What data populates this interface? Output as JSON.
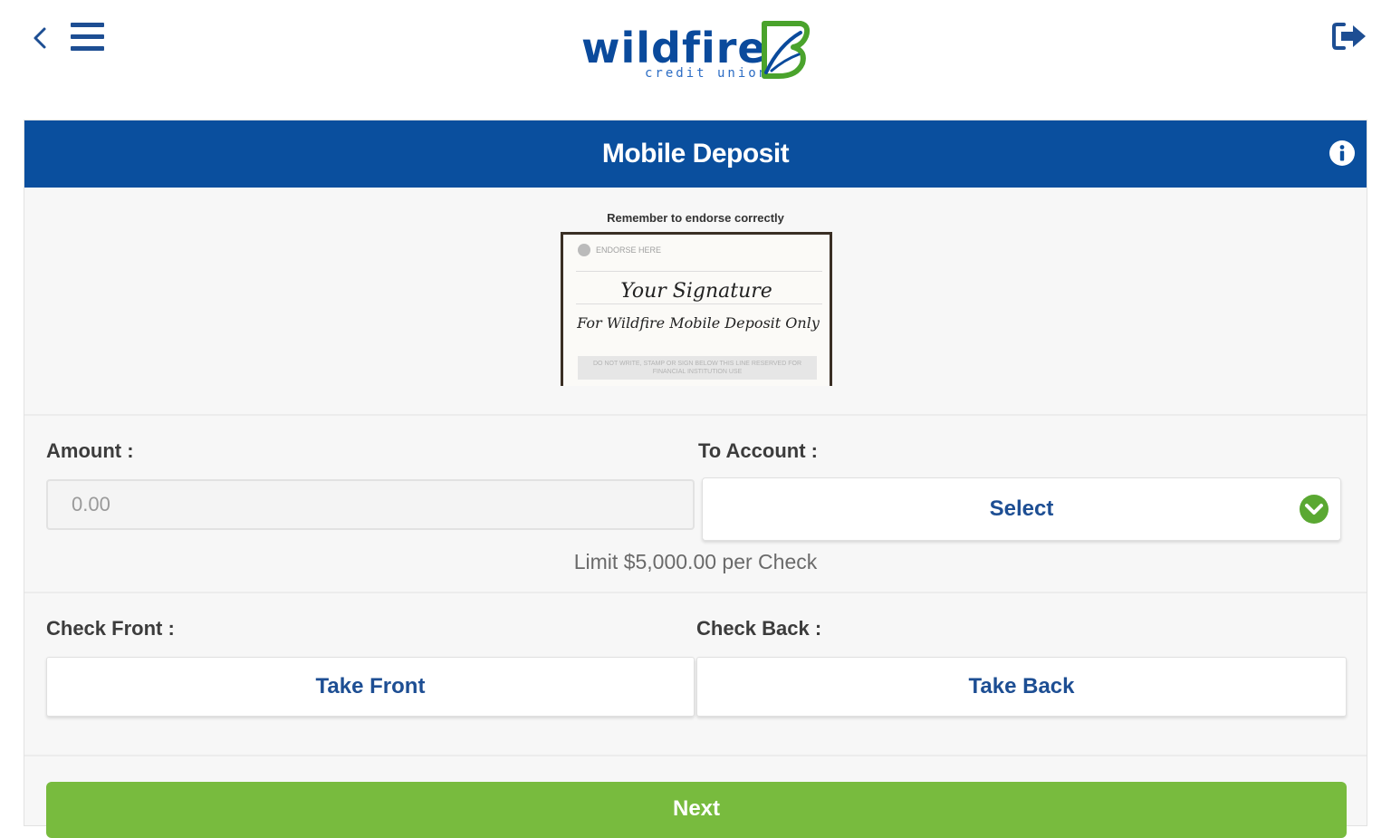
{
  "header": {
    "logo_word": "wildfire",
    "logo_sub": "credit union"
  },
  "card": {
    "title": "Mobile Deposit",
    "endorse_caption": "Remember to endorse correctly",
    "check_image": {
      "endorse_here": "ENDORSE HERE",
      "signature": "Your Signature",
      "restriction": "For Wildfire Mobile Deposit Only",
      "disclaimer": "DO NOT WRITE, STAMP OR SIGN BELOW THIS LINE RESERVED FOR FINANCIAL INSTITUTION USE"
    }
  },
  "form": {
    "amount_label": "Amount :",
    "amount_placeholder": "0.00",
    "account_label": "To Account :",
    "account_select": "Select",
    "limit_text": "Limit $5,000.00 per Check",
    "front_label": "Check Front :",
    "back_label": "Check Back :",
    "take_front": "Take Front",
    "take_back": "Take Back",
    "next": "Next"
  },
  "colors": {
    "brand_blue": "#0a4f9e",
    "link_blue": "#1d4e93",
    "next_green": "#78bb3e",
    "chevron_green": "#5aa832"
  },
  "icons": [
    "back-icon",
    "menu-icon",
    "logout-icon",
    "info-icon",
    "chevron-down-icon"
  ]
}
